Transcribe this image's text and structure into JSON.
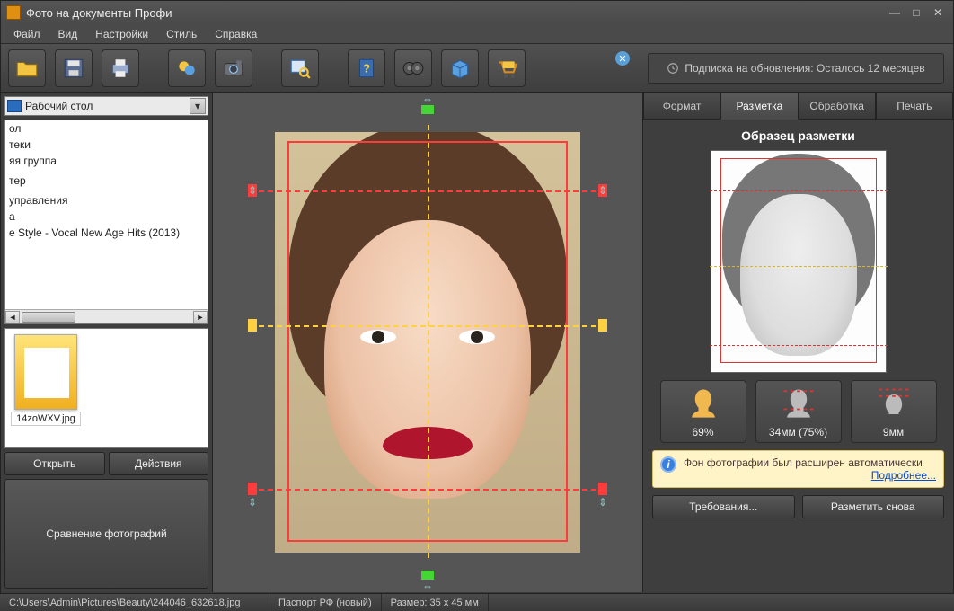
{
  "window": {
    "title": "Фото на документы Профи"
  },
  "menu": {
    "items": [
      "Файл",
      "Вид",
      "Настройки",
      "Стиль",
      "Справка"
    ]
  },
  "subscription": {
    "label": "Подписка на обновления: Осталось 12 месяцев"
  },
  "left": {
    "location": "Рабочий стол",
    "tree": [
      "ол",
      "теки",
      "яя группа",
      "",
      "тер",
      "",
      "управления",
      "а",
      "e Style - Vocal New Age Hits (2013)"
    ],
    "thumb_name": "14zoWXV.jpg",
    "btn_open": "Открыть",
    "btn_actions": "Действия",
    "btn_compare": "Сравнение фотографий"
  },
  "right": {
    "tabs": [
      "Формат",
      "Разметка",
      "Обработка",
      "Печать"
    ],
    "active_tab": 1,
    "sample_title": "Образец разметки",
    "metrics": [
      {
        "label": "69%"
      },
      {
        "label": "34мм (75%)"
      },
      {
        "label": "9мм"
      }
    ],
    "info_text": "Фон фотографии был расширен автоматически",
    "info_more": "Подробнее...",
    "btn_req": "Требования...",
    "btn_remark": "Разметить снова"
  },
  "status": {
    "path": "C:\\Users\\Admin\\Pictures\\Beauty\\244046_632618.jpg",
    "doc_type": "Паспорт РФ (новый)",
    "size": "Размер: 35 x 45 мм"
  }
}
